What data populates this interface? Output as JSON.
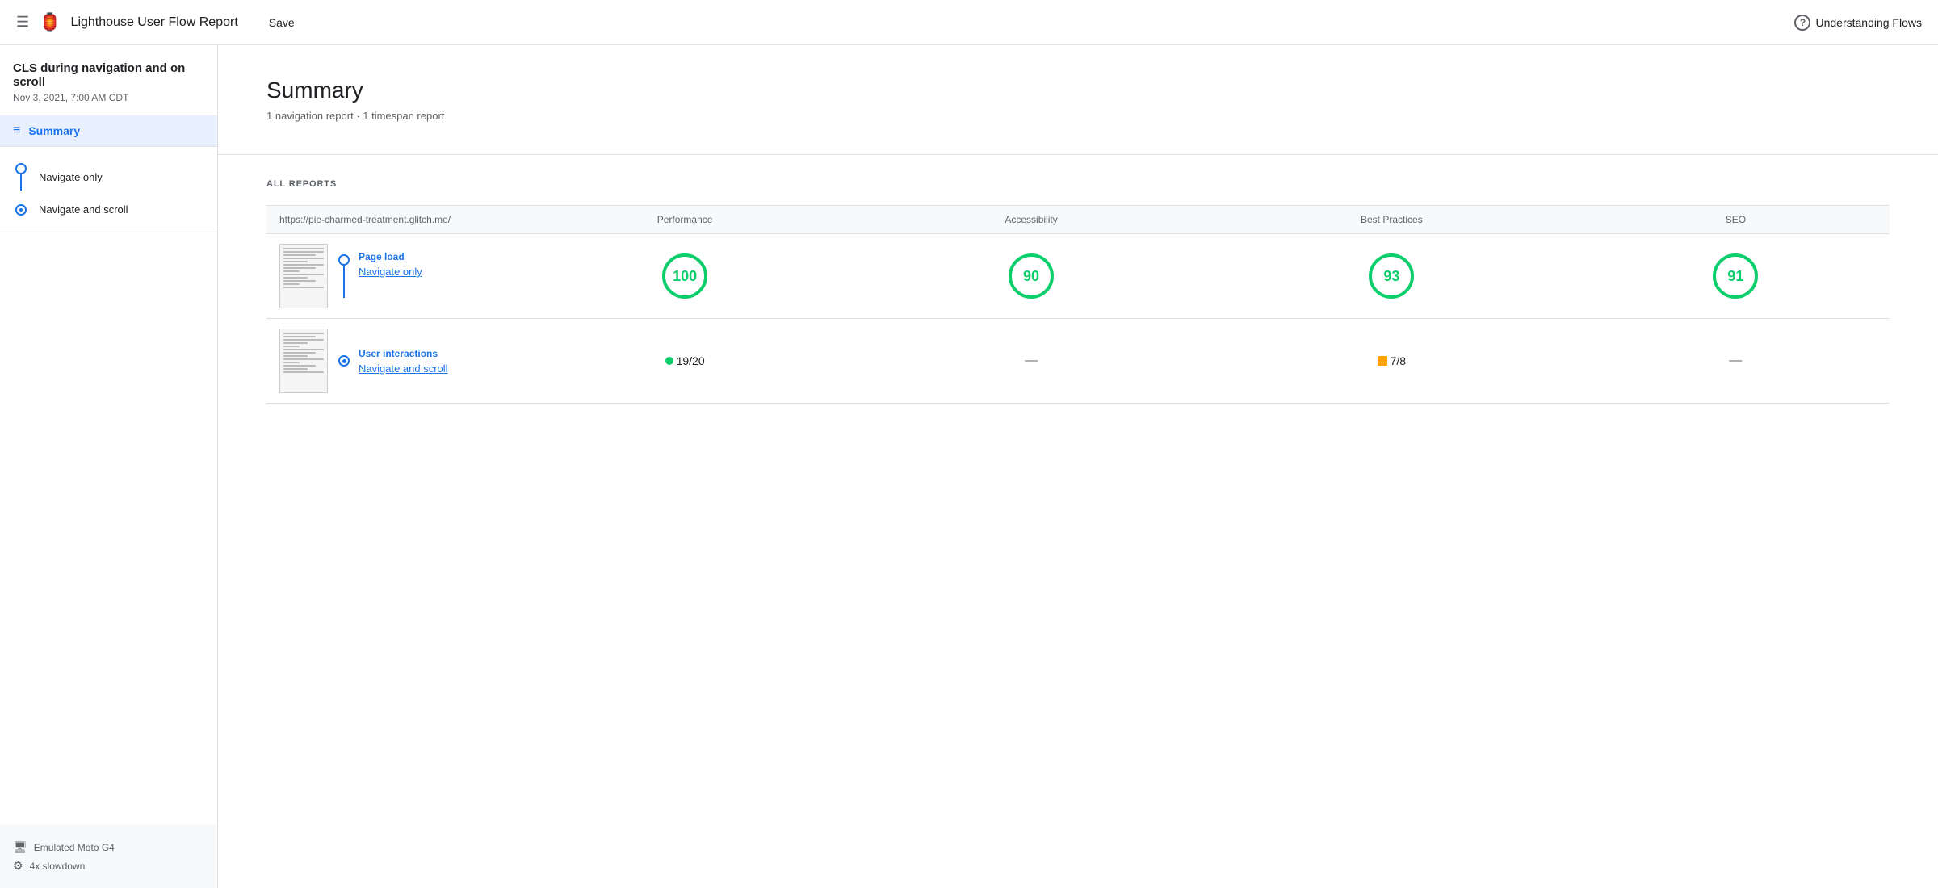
{
  "header": {
    "menu_label": "☰",
    "logo": "🏮",
    "title": "Lighthouse User Flow Report",
    "save_label": "Save",
    "understanding_label": "Understanding Flows"
  },
  "sidebar": {
    "project_title": "CLS during navigation and on scroll",
    "project_date": "Nov 3, 2021, 7:00 AM CDT",
    "summary_label": "Summary",
    "flow_items": [
      {
        "label": "Navigate only",
        "type": "nav"
      },
      {
        "label": "Navigate and scroll",
        "type": "timer"
      }
    ],
    "device_items": [
      {
        "icon": "🖥",
        "label": "Emulated Moto G4"
      },
      {
        "icon": "⚙",
        "label": "4x slowdown"
      }
    ]
  },
  "content": {
    "summary_title": "Summary",
    "summary_subtitle": "1 navigation report · 1 timespan report",
    "all_reports_label": "ALL REPORTS",
    "url": "https://pie-charmed-treatment.glitch.me/",
    "columns": [
      "Performance",
      "Accessibility",
      "Best Practices",
      "SEO"
    ],
    "rows": [
      {
        "type": "Page load",
        "name": "Navigate only",
        "connector": "nav",
        "performance": "100",
        "accessibility": "90",
        "best_practices": "93",
        "seo": "91",
        "row_type": "navigation"
      },
      {
        "type": "User interactions",
        "name": "Navigate and scroll",
        "connector": "timer",
        "performance_timespan": "19/20",
        "best_practices_timespan": "7/8",
        "row_type": "timespan"
      }
    ]
  }
}
